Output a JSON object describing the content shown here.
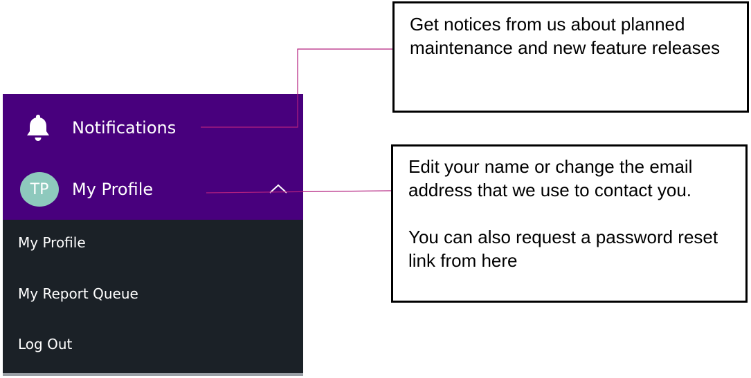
{
  "nav": {
    "notifications_label": "Notifications",
    "profile_label": "My Profile",
    "avatar_initials": "TP",
    "submenu": [
      {
        "label": "My Profile"
      },
      {
        "label": "My Report Queue"
      },
      {
        "label": "Log Out"
      }
    ]
  },
  "callouts": {
    "notifications": {
      "text": "Get notices from us about planned maintenance and new feature releases"
    },
    "profile": {
      "paragraph_1": "Edit your name or change the email address that we use to contact you.",
      "paragraph_2": "You can also request a password reset link from here"
    }
  },
  "icons": {
    "notifications": "bell-icon",
    "profile_toggle": "chevron-up-icon"
  },
  "colors": {
    "nav_header_bg": "#48007d",
    "nav_submenu_bg": "#1b2127",
    "avatar_bg": "#8ec9bd",
    "connector_line": "#b3207f"
  }
}
